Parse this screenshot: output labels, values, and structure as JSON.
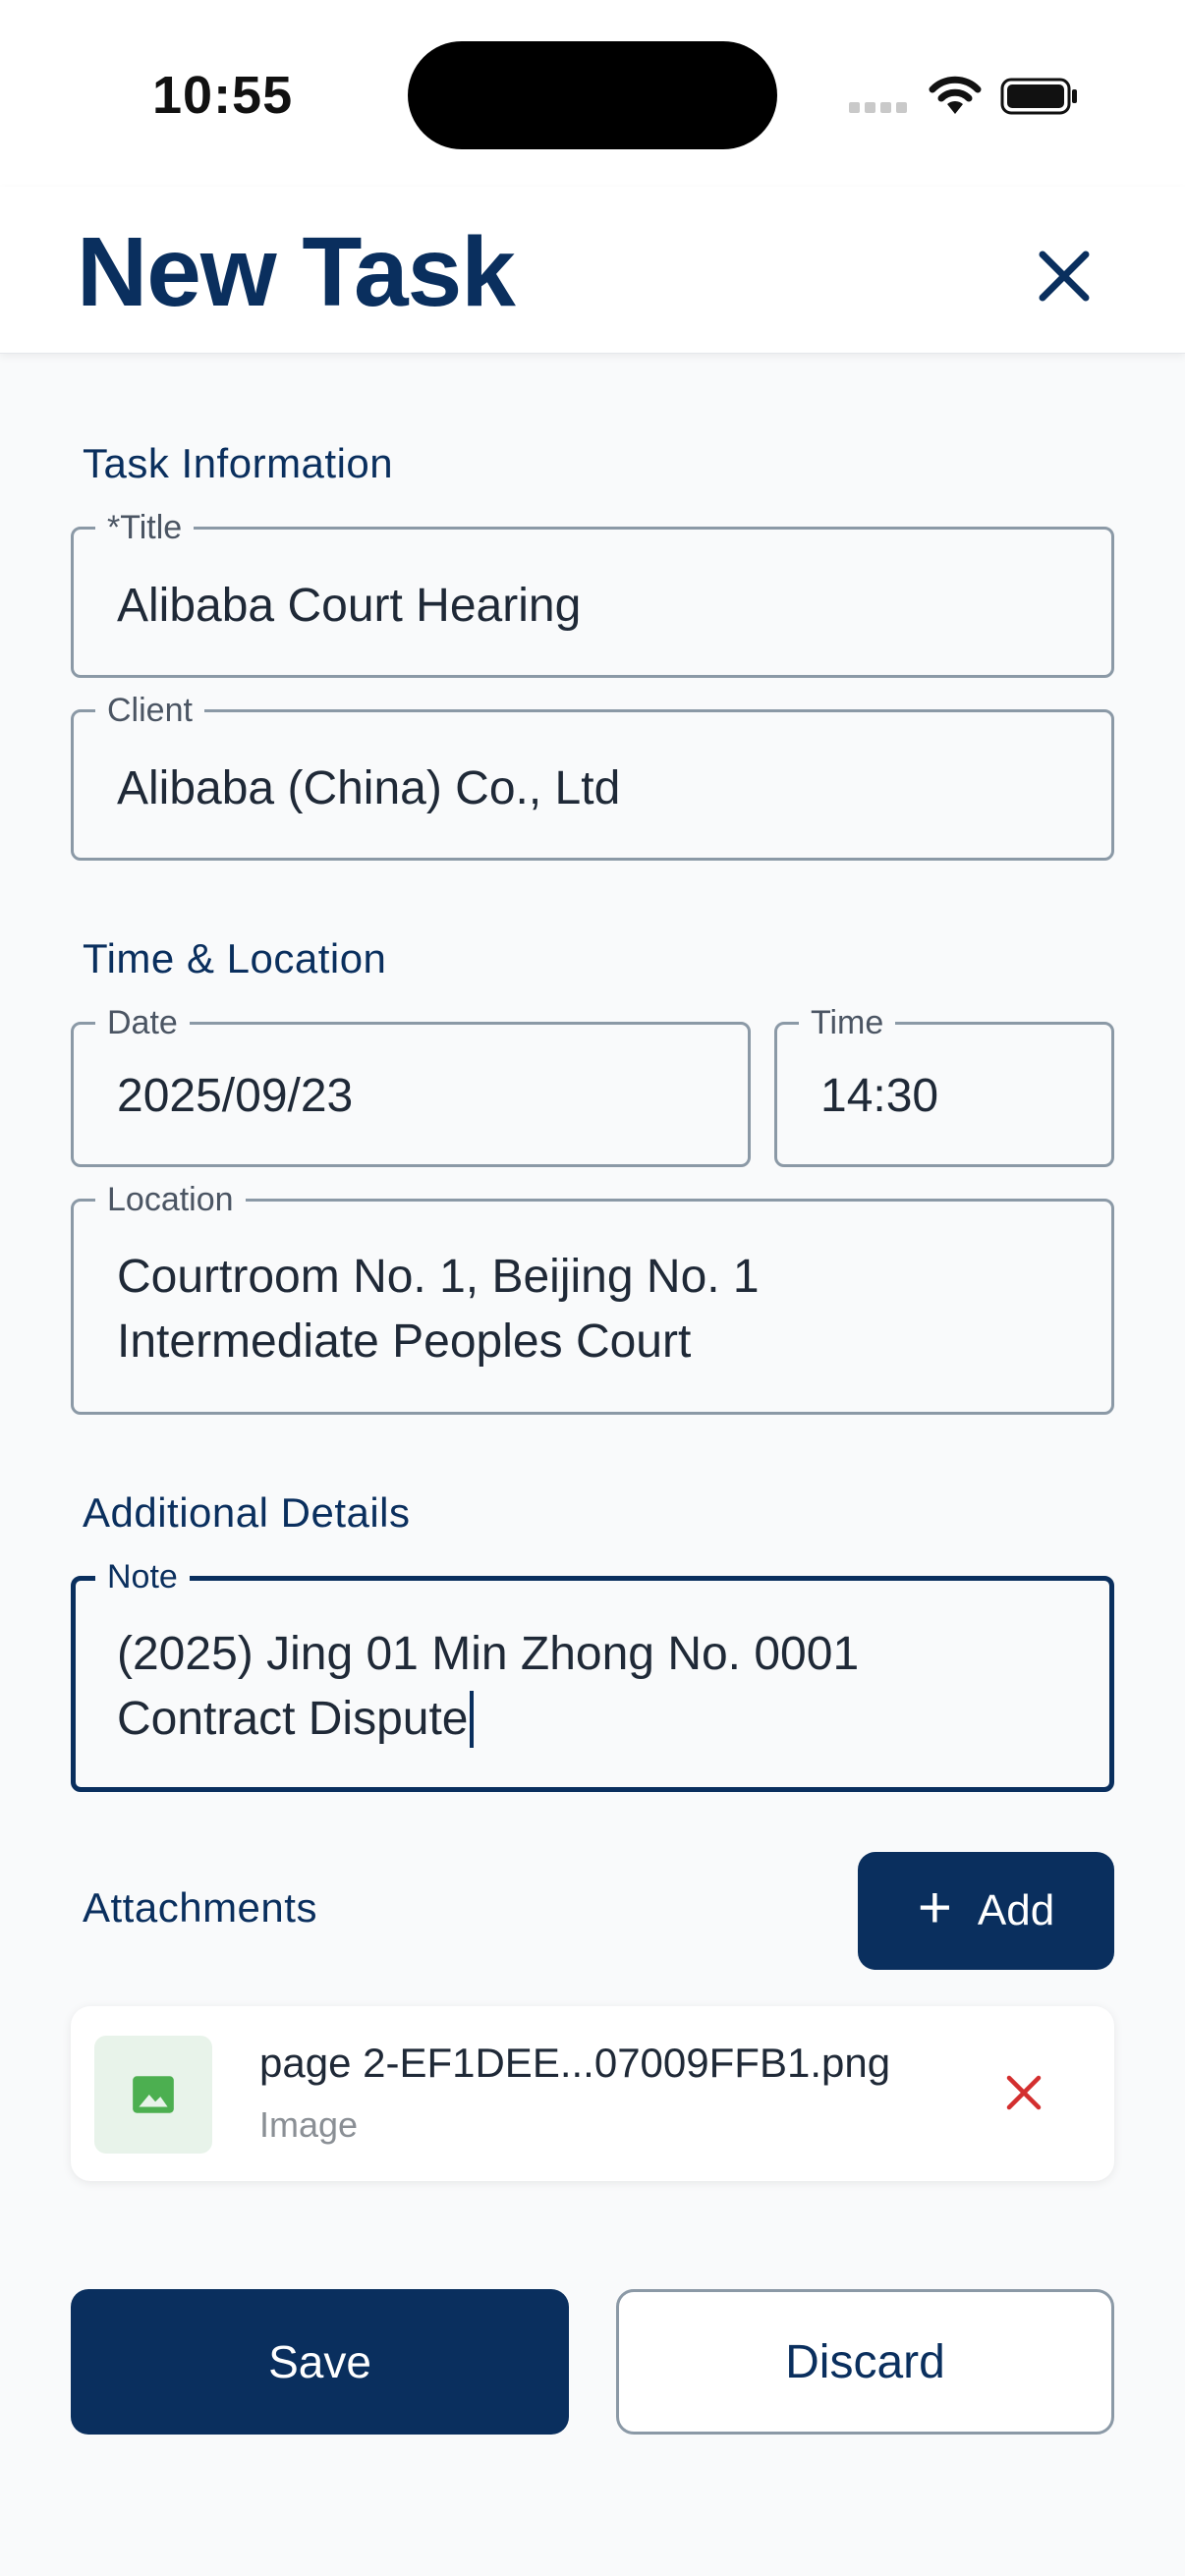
{
  "status_bar": {
    "time": "10:55"
  },
  "header": {
    "title": "New Task",
    "close_icon": "close-icon"
  },
  "sections": {
    "task_info": "Task Information",
    "time_location": "Time & Location",
    "additional": "Additional Details",
    "attachments": "Attachments"
  },
  "fields": {
    "title": {
      "label": "*Title",
      "value": "Alibaba Court Hearing"
    },
    "client": {
      "label": "Client",
      "value": "Alibaba (China) Co., Ltd"
    },
    "date": {
      "label": "Date",
      "value": "2025/09/23"
    },
    "time": {
      "label": "Time",
      "value": "14:30"
    },
    "location": {
      "label": "Location",
      "value": "Courtroom No. 1, Beijing No. 1\nIntermediate Peoples Court"
    },
    "note": {
      "label": "Note",
      "value": "(2025) Jing 01 Min Zhong No. 0001\nContract Dispute"
    }
  },
  "attachments": {
    "add_label": "Add",
    "items": [
      {
        "name": "page 2-EF1DEE...07009FFB1.png",
        "type": "Image",
        "icon": "image-icon"
      }
    ]
  },
  "actions": {
    "save_label": "Save",
    "discard_label": "Discard"
  },
  "colors": {
    "primary": "#0a2f5e",
    "remove": "#d32f2f",
    "image_icon": "#4caf50"
  }
}
